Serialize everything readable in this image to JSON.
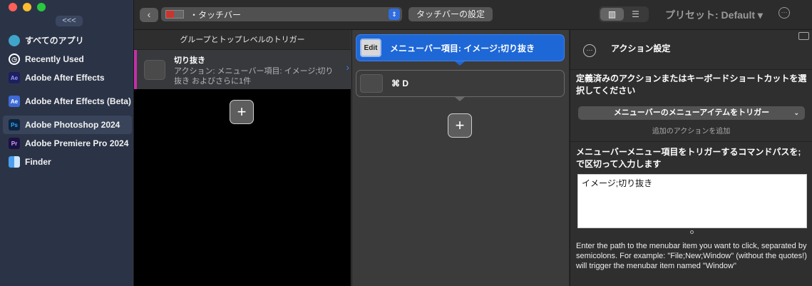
{
  "sidebar": {
    "collapse_label": "<<<",
    "apps": [
      {
        "label": "すべてのアプリ",
        "icon": "globe-icon",
        "icon_text": "",
        "icon_bg": "#3fa5c9"
      },
      {
        "label": "Recently Used",
        "icon": "clock-icon",
        "icon_text": "",
        "icon_bg": "#2b3447"
      },
      {
        "label": "Adobe After Effects",
        "icon": "after-effects-icon",
        "icon_text": "Ae",
        "icon_bg": "#1d1f5e"
      },
      {
        "label": "Adobe After Effects (Beta)",
        "icon": "after-effects-beta-icon",
        "icon_text": "Ae",
        "icon_bg": "#3d6ad6"
      },
      {
        "label": "Adobe Photoshop 2024",
        "icon": "photoshop-icon",
        "icon_text": "Ps",
        "icon_bg": "#0c2340"
      },
      {
        "label": "Adobe Premiere Pro 2024",
        "icon": "premiere-icon",
        "icon_text": "Pr",
        "icon_bg": "#1b1242"
      },
      {
        "label": "Finder",
        "icon": "finder-icon",
        "icon_text": "",
        "icon_bg": "#4a9ef0"
      }
    ]
  },
  "toolbar": {
    "back_label": "‹",
    "bar_name": "・タッチバー",
    "settings_label": "タッチバーの設定",
    "preset_label": "プリセット: Default ▾",
    "more_label": "···"
  },
  "groups": {
    "header": "グループとトップレベルのトリガー",
    "items": [
      {
        "title": "切り抜き",
        "subtitle": "アクション: メニューバー項目: イメージ;切り抜き およびさらに1件"
      }
    ],
    "add_label": "+"
  },
  "actions": {
    "items": [
      {
        "icon_text": "Edit",
        "label": "メニューバー項目: イメージ;切り抜き",
        "selected": true
      },
      {
        "icon_text": "",
        "label": "⌘ D",
        "selected": false
      }
    ],
    "add_label": "+"
  },
  "config": {
    "title": "アクション設定",
    "dots_label": "···",
    "section1": "定義済みのアクションまたはキーボードショートカットを選択してください",
    "trigger_select": "メニューバーのメニューアイテムをトリガー",
    "add_action": "追加のアクションを追加",
    "section2": "メニューバーメニュー項目をトリガーするコマンドパスを; で区切って入力します",
    "path_value": "イメージ;切り抜き",
    "help": "Enter the path to the menubar item you want to click, separated by semicolons. For example: \"File;New;Window\" (without the quotes!) will trigger the menubar item named \"Window\""
  },
  "colors": {
    "sidebar_bg": "#2b3447",
    "accent_blue": "#1e67d6",
    "group_accent": "#c42fa8"
  }
}
